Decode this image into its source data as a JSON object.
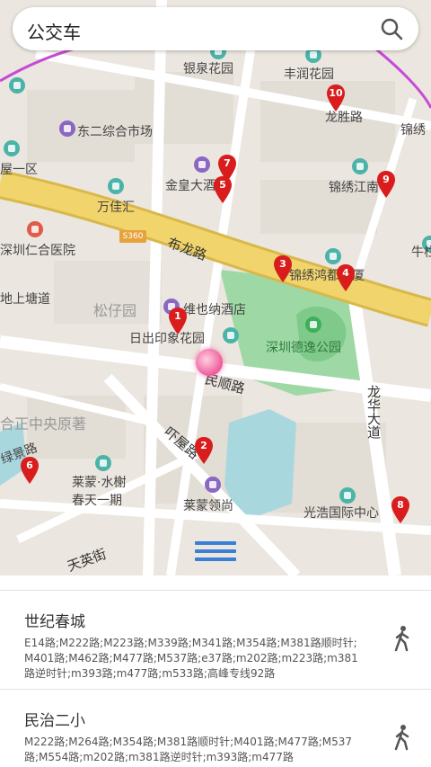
{
  "search": {
    "title": "公交车",
    "icon": "search-icon"
  },
  "map": {
    "labels": {
      "yinquan": "银泉花园",
      "fengrun": "丰润花园",
      "longsheng": "龙胜路",
      "jinxiu_n": "锦绣",
      "dongerzonghe": "东二综合市场",
      "wuyiqu": "屋一区",
      "jinhuang": "金皇大酒店",
      "jinxiujiang": "锦绣江南",
      "wanjiahui": "万佳汇",
      "route_sign": "S360",
      "bulong": "布龙路",
      "hospital": "深圳仁合医院",
      "niu": "牛栏",
      "jinxiuhong": "锦绣鸿都大厦",
      "dishangtang": "地上塘道",
      "songziyuan": "松仔园",
      "weiyena": "维也纳酒店",
      "richu": "日出印象花园",
      "deyi": "深圳德逸公园",
      "minshun": "民顺路",
      "longhua": "龙华大道",
      "hezheng": "合正中央原著",
      "luyuan": "绿景路",
      "baiyu": "吓屋路",
      "laimeng_shuixie": "莱蒙·水榭",
      "chuntian": "春天一期",
      "laimeng_lingshang": "莱蒙领尚",
      "guanghao": "光浩国际中心",
      "tianying": "天英街"
    },
    "markers": [
      "1",
      "2",
      "3",
      "4",
      "5",
      "6",
      "7",
      "8",
      "9",
      "10"
    ],
    "colors": {
      "road_major": "#f2d46c",
      "park": "#9ed9a5",
      "boundary": "#c64ad6",
      "marker": "#d91d1d",
      "menu": "#3a7fd5"
    }
  },
  "list": {
    "items": [
      {
        "title": "世纪春城",
        "routes": "E14路;M222路;M223路;M339路;M341路;M354路;M381路顺时针;M401路;M462路;M477路;M537路;e37路;m202路;m223路;m381路逆时针;m393路;m477路;m533路;高峰专线92路",
        "icon": "walking-person-icon"
      },
      {
        "title": "民治二小",
        "routes": "M222路;M264路;M354路;M381路顺时针;M401路;M477路;M537路;M554路;m202路;m381路逆时针;m393路;m477路",
        "icon": "walking-person-icon"
      }
    ]
  }
}
